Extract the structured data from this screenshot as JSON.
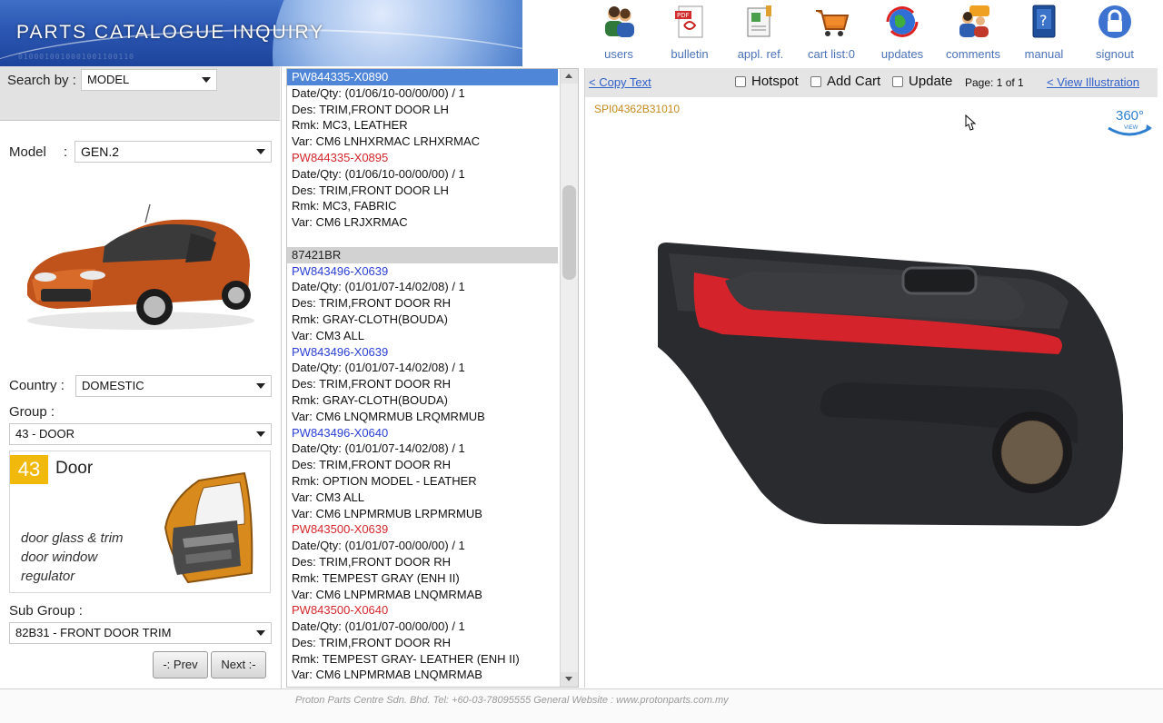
{
  "banner": {
    "title": "PARTS CATALOGUE INQUIRY",
    "binary": "0100010010001001100110"
  },
  "toolbar": [
    {
      "label": "users",
      "icon": "users-icon"
    },
    {
      "label": "bulletin",
      "icon": "pdf-bulletin-icon"
    },
    {
      "label": "appl. ref.",
      "icon": "document-reference-icon"
    },
    {
      "label": "cart list:0",
      "icon": "shopping-cart-icon"
    },
    {
      "label": "updates",
      "icon": "globe-refresh-icon"
    },
    {
      "label": "comments",
      "icon": "comments-icon"
    },
    {
      "label": "manual",
      "icon": "manual-book-icon"
    },
    {
      "label": "signout",
      "icon": "lock-icon"
    }
  ],
  "search": {
    "label": "Search by :",
    "value": "MODEL"
  },
  "filters": {
    "model_label": "Model",
    "model_sep": ":",
    "model_value": "GEN.2",
    "country_label": "Country :",
    "country_value": "DOMESTIC",
    "group_label": "Group :",
    "group_value": "43 - DOOR",
    "subgroup_label": "Sub Group :",
    "subgroup_value": "82B31 - FRONT DOOR TRIM"
  },
  "group_card": {
    "number": "43",
    "name": "Door",
    "desc": [
      "door glass & trim",
      "door window",
      "regulator"
    ]
  },
  "nav": {
    "prev": "-: Prev",
    "next": "Next :-"
  },
  "parts_list": [
    {
      "text": "PW844335-X0890",
      "style": "hdr-sel"
    },
    {
      "text": "Date/Qty: (01/06/10-00/00/00) / 1",
      "style": ""
    },
    {
      "text": "Des: TRIM,FRONT DOOR LH",
      "style": ""
    },
    {
      "text": "Rmk: MC3, LEATHER",
      "style": ""
    },
    {
      "text": "Var: CM6 LNHXRMAC LRHXRMAC",
      "style": ""
    },
    {
      "text": "PW844335-X0895",
      "style": "part-red"
    },
    {
      "text": "Date/Qty: (01/06/10-00/00/00) / 1",
      "style": ""
    },
    {
      "text": "Des: TRIM,FRONT DOOR LH",
      "style": ""
    },
    {
      "text": "Rmk: MC3, FABRIC",
      "style": ""
    },
    {
      "text": "Var: CM6 LRJXRMAC",
      "style": ""
    },
    {
      "text": "",
      "style": "blank"
    },
    {
      "text": "87421BR",
      "style": "hdr-grey"
    },
    {
      "text": "PW843496-X0639",
      "style": "part-blue"
    },
    {
      "text": "Date/Qty: (01/01/07-14/02/08) / 1",
      "style": ""
    },
    {
      "text": "Des: TRIM,FRONT DOOR RH",
      "style": ""
    },
    {
      "text": "Rmk: GRAY-CLOTH(BOUDA)",
      "style": ""
    },
    {
      "text": "Var: CM3 ALL",
      "style": ""
    },
    {
      "text": "PW843496-X0639",
      "style": "part-blue"
    },
    {
      "text": "Date/Qty: (01/01/07-14/02/08) / 1",
      "style": ""
    },
    {
      "text": "Des: TRIM,FRONT DOOR RH",
      "style": ""
    },
    {
      "text": "Rmk: GRAY-CLOTH(BOUDA)",
      "style": ""
    },
    {
      "text": "Var: CM6 LNQMRMUB LRQMRMUB",
      "style": ""
    },
    {
      "text": "PW843496-X0640",
      "style": "part-blue"
    },
    {
      "text": "Date/Qty: (01/01/07-14/02/08) / 1",
      "style": ""
    },
    {
      "text": "Des: TRIM,FRONT DOOR RH",
      "style": ""
    },
    {
      "text": "Rmk: OPTION MODEL - LEATHER",
      "style": ""
    },
    {
      "text": "Var: CM3 ALL",
      "style": ""
    },
    {
      "text": "Var: CM6 LNPMRMUB LRPMRMUB",
      "style": ""
    },
    {
      "text": "PW843500-X0639",
      "style": "part-red"
    },
    {
      "text": "Date/Qty: (01/01/07-00/00/00) / 1",
      "style": ""
    },
    {
      "text": "Des: TRIM,FRONT DOOR RH",
      "style": ""
    },
    {
      "text": "Rmk: TEMPEST GRAY (ENH II)",
      "style": ""
    },
    {
      "text": "Var: CM6 LNPMRMAB LNQMRMAB",
      "style": ""
    },
    {
      "text": "PW843500-X0640",
      "style": "part-red"
    },
    {
      "text": "Date/Qty: (01/01/07-00/00/00) / 1",
      "style": ""
    },
    {
      "text": "Des: TRIM,FRONT DOOR RH",
      "style": ""
    },
    {
      "text": "Rmk: TEMPEST GRAY- LEATHER (ENH II)",
      "style": ""
    },
    {
      "text": "Var: CM6 LNPMRMAB LNQMRMAB",
      "style": ""
    }
  ],
  "viewer": {
    "copy_text": "< Copy Text",
    "hotspot": "Hotspot",
    "add_cart": "Add Cart",
    "update": "Update",
    "page_info": "Page: 1 of 1",
    "view_illustration": "< View Illustration",
    "illustration_code": "SPI04362B31010",
    "rotate_label": "360°",
    "rotate_sub": "VIEW"
  },
  "footer": {
    "text": "Proton Parts Centre Sdn. Bhd.   Tel: +60-03-78095555   General Website : www.protonparts.com.my"
  },
  "colors": {
    "accent_blue": "#4f86d8",
    "link_blue": "#2f5fc8",
    "part_red": "#d3282d",
    "part_blue": "#2b3fd3",
    "group_badge": "#f2b90d",
    "illus_code": "#c48a1e"
  }
}
